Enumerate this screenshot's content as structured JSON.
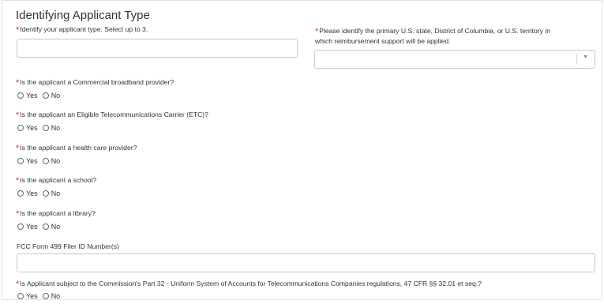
{
  "section": {
    "title": "Identifying Applicant Type"
  },
  "applicant_type": {
    "label": "Identify your applicant type. Select up to 3.",
    "value": ""
  },
  "state": {
    "label_line1": "Please identify the primary U.S. state, District of Columbia, or U.S. territory in",
    "label_line2": "which reimbursement support will be applied.",
    "selected": "",
    "arrow": "▼"
  },
  "required_mark": "*",
  "questions": [
    {
      "label": "Is the applicant a Commercial broadband provider?"
    },
    {
      "label": "Is the applicant an Eligible Telecommunications Carrier (ETC)?"
    },
    {
      "label": "Is the applicant a health care provider?"
    },
    {
      "label": "Is the applicant a school?"
    },
    {
      "label": "Is the applicant a library?"
    }
  ],
  "options": {
    "yes": "Yes",
    "no": "No"
  },
  "filer_id": {
    "label": "FCC Form 499 Filer ID Number(s)",
    "value": ""
  },
  "part32": {
    "label": "Is Applicant subject to the Commission's Part 32 - Uniform System of Accounts for Telecommunications Companies regulations, 47 CFR §§ 32.01 et seq.?"
  },
  "colors": {
    "required": "#c23934",
    "border": "#c9c9c9"
  }
}
